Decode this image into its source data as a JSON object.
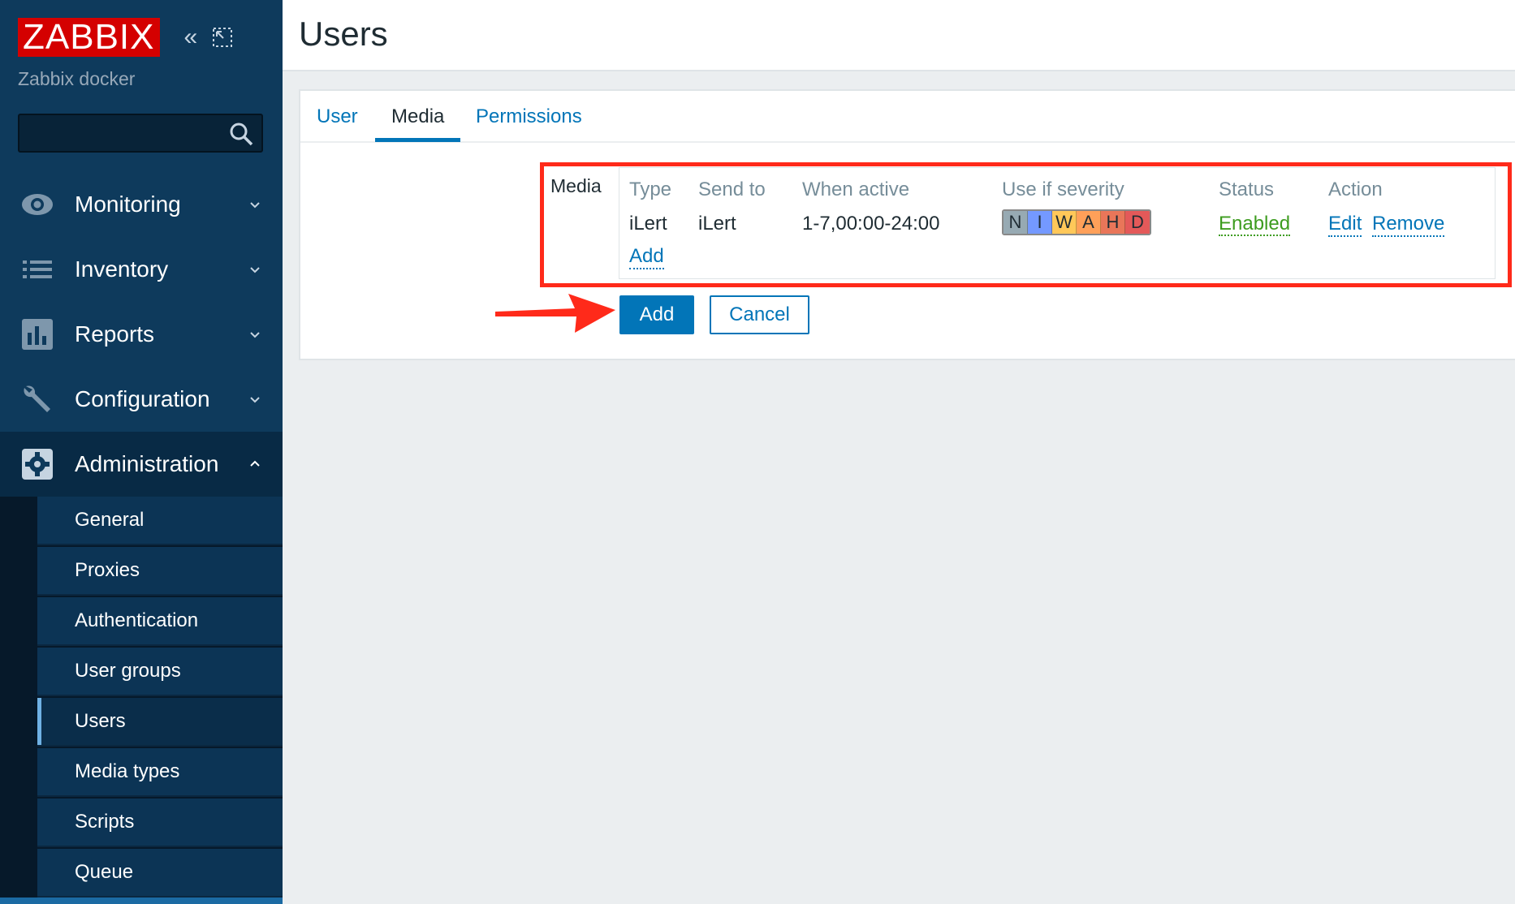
{
  "brand": {
    "logo_text": "ZABBIX",
    "instance_name": "Zabbix docker"
  },
  "sidebar": {
    "collapse_icon": "double-chevron-left-icon",
    "kiosk_icon": "expand-icon",
    "search": {
      "placeholder": "",
      "value": ""
    },
    "menu": [
      {
        "label": "Monitoring",
        "icon": "eye-icon"
      },
      {
        "label": "Inventory",
        "icon": "list-icon"
      },
      {
        "label": "Reports",
        "icon": "bar-chart-icon"
      },
      {
        "label": "Configuration",
        "icon": "wrench-icon"
      },
      {
        "label": "Administration",
        "icon": "gear-icon",
        "expanded": true
      }
    ],
    "admin_submenu": [
      "General",
      "Proxies",
      "Authentication",
      "User groups",
      "Users",
      "Media types",
      "Scripts",
      "Queue"
    ],
    "active_submenu": "Users"
  },
  "header": {
    "title": "Users"
  },
  "tabs": [
    {
      "label": "User"
    },
    {
      "label": "Media",
      "active": true
    },
    {
      "label": "Permissions"
    }
  ],
  "media": {
    "label": "Media",
    "columns": [
      "Type",
      "Send to",
      "When active",
      "Use if severity",
      "Status",
      "Action"
    ],
    "rows": [
      {
        "type": "iLert",
        "send_to": "iLert",
        "when_active": "1-7,00:00-24:00",
        "severities": [
          {
            "letter": "N",
            "color": "#97aab3"
          },
          {
            "letter": "I",
            "color": "#7499ff"
          },
          {
            "letter": "W",
            "color": "#ffc859"
          },
          {
            "letter": "A",
            "color": "#ffa059"
          },
          {
            "letter": "H",
            "color": "#e97659"
          },
          {
            "letter": "D",
            "color": "#e45959"
          }
        ],
        "status": "Enabled",
        "actions": [
          "Edit",
          "Remove"
        ]
      }
    ],
    "add_link": "Add"
  },
  "buttons": {
    "add": "Add",
    "cancel": "Cancel"
  },
  "colors": {
    "accent": "#0275b8",
    "sidebar": "#0e3a5c",
    "highlight": "#ff2a1a",
    "status_enabled": "#3d9c1f"
  }
}
